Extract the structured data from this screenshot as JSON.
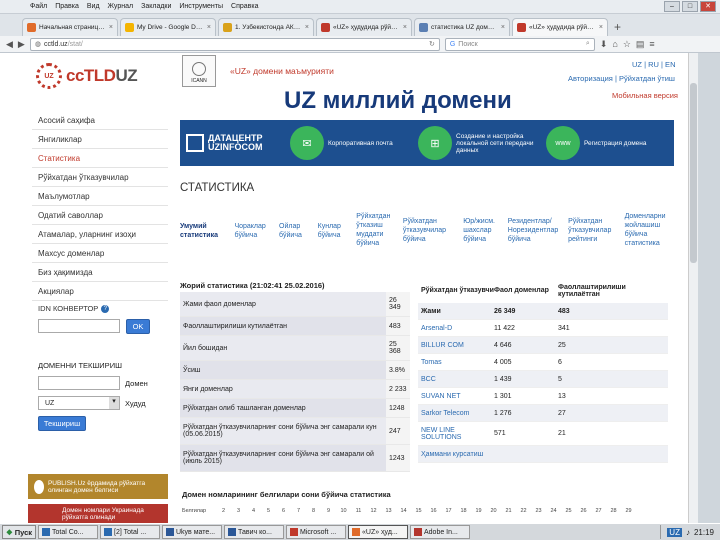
{
  "menu": [
    "Файл",
    "Правка",
    "Вид",
    "Журнал",
    "Закладки",
    "Инструменты",
    "Справка"
  ],
  "tabs": [
    {
      "label": "Начальная страница ...",
      "color": "#e06b2a"
    },
    {
      "label": "My Drive - Google Drive",
      "color": "#f4b400"
    },
    {
      "label": "1. Ўзбекистонда АКТ р...",
      "color": "#d9a21b"
    },
    {
      "label": "«UZ» ҳудудида рўйхат...",
      "color": "#c0392b"
    },
    {
      "label": "статистика UZ домени...",
      "color": "#5b7fb3"
    },
    {
      "label": "«UZ» ҳудудида рўйхат...",
      "color": "#c0392b",
      "active": true
    }
  ],
  "nav": {
    "url": "cctld.uz",
    "url_rest": "/stat/",
    "search_placeholder": "Поиск"
  },
  "header": {
    "logo_prefix": "ccTLD",
    "logo_suffix": "UZ",
    "badge": "UZ",
    "icann": "ICANN",
    "admin": "«UZ» домени маъмурияти",
    "langs": "UZ | RU | EN",
    "auth": "Авторизация | Рўйхатдан ўтиш",
    "mobile": "Мобильная версия"
  },
  "page_title": "UZ миллий домени",
  "sidebar": [
    {
      "label": "Асосий саҳифа"
    },
    {
      "label": "Янгиликлар"
    },
    {
      "label": "Статистика",
      "active": true
    },
    {
      "label": "Рўйхатдан ўтказувчилар"
    },
    {
      "label": "Маълумотлар"
    },
    {
      "label": "Одатий саволлар"
    },
    {
      "label": "Атамалар, уларнинг изоҳи"
    },
    {
      "label": "Махсус доменлар"
    },
    {
      "label": "Биз ҳақимизда"
    },
    {
      "label": "Акциялар"
    }
  ],
  "idn": {
    "title": "IDN КОНВЕРТОР",
    "ok": "OK"
  },
  "check": {
    "title": "ДОМЕННИ ТЕКШИРИШ",
    "domain_label": "Домен",
    "zone_label": "Худуд",
    "zone_value": "UZ",
    "button": "Текшириш"
  },
  "banners": [
    "PUBLISH.Uz ёрдамида рўйхатга олинган домен белгиси",
    "Домен номлари Украинада рўйхатга олинади"
  ],
  "dc_banner": {
    "brand_line1": "ДАТАЦЕНТР",
    "brand_line2": "UZINFOCOM",
    "services": [
      "Корпоративная почта",
      "Создание и настройка локальной сети передачи данных",
      "Регистрация домена"
    ]
  },
  "stat_heading": "СТАТИСТИКА",
  "stat_tabs": [
    "Умумий статистика",
    "Чораклар бўйича",
    "Ойлар бўйича",
    "Кунлар бўйича",
    "Рўйхатдан ўтказиш муддати бўйича",
    "Рўйхатдан ўтказувчилар бўйича",
    "Юр/жисм. шахслар бўйича",
    "Резидентлар/ Норезидентлар бўйича",
    "Рўйхатдан ўтказувчилар рейтинги",
    "Доменларни жойлашиш бўйича статистика"
  ],
  "current_stats": {
    "title": "Жорий статистика (21:02:41 25.02.2016)",
    "rows": [
      {
        "k": "Жами фаол доменлар",
        "v": "26 349"
      },
      {
        "k": "Фаоллаштирилиши кутилаётган",
        "v": "483"
      },
      {
        "k": "Йил бошидан",
        "v": "25 368"
      },
      {
        "k": "Ўсиш",
        "v": "3.8%"
      },
      {
        "k": "Янги доменлар",
        "v": "2 233"
      },
      {
        "k": "Рўйхатдан олиб ташланган доменлар",
        "v": "1248"
      },
      {
        "k": "Рўйхатдан ўтказувчиларнинг сони бўйича энг самарали кун (05.06.2015)",
        "v": "247"
      },
      {
        "k": "Рўйхатдан ўтказувчиларнинг сони бўйича энг самарали ой (июль 2015)",
        "v": "1243"
      }
    ]
  },
  "registrars": {
    "headers": [
      "Рўйхатдан ўтказувчи",
      "Фаол доменлар",
      "Фаоллаштирилиши кутилаётган"
    ],
    "rows": [
      {
        "name": "Жами",
        "active": "26 349",
        "pending": "483",
        "total": true
      },
      {
        "name": "Arsenal-D",
        "active": "11 422",
        "pending": "341"
      },
      {
        "name": "BILLUR COM",
        "active": "4 646",
        "pending": "25"
      },
      {
        "name": "Tomas",
        "active": "4 005",
        "pending": "6"
      },
      {
        "name": "BCC",
        "active": "1 439",
        "pending": "5"
      },
      {
        "name": "SUVAN NET",
        "active": "1 301",
        "pending": "13"
      },
      {
        "name": "Sarkor Telecom",
        "active": "1 276",
        "pending": "27"
      },
      {
        "name": "NEW LINE SOLUTIONS",
        "active": "571",
        "pending": "21"
      },
      {
        "name": "Ҳаммани курсатиш",
        "active": "",
        "pending": ""
      }
    ]
  },
  "daily": {
    "title": "Домен номларининг белгилари сони бўйича статистика",
    "row_label": "Белгилар",
    "days": [
      "2",
      "3",
      "4",
      "5",
      "6",
      "7",
      "8",
      "9",
      "10",
      "11",
      "12",
      "13",
      "14",
      "15",
      "16",
      "17",
      "18",
      "19",
      "20",
      "21",
      "22",
      "23",
      "24",
      "25",
      "26",
      "27",
      "28",
      "29"
    ]
  },
  "taskbar": {
    "start": "Пуск",
    "tasks": [
      {
        "label": "Total Co...",
        "color": "#2a6ab0"
      },
      {
        "label": "[2] Total ...",
        "color": "#2a6ab0"
      },
      {
        "label": "Ukyв мате...",
        "color": "#2b5797"
      },
      {
        "label": "Тавич ко...",
        "color": "#2b5797"
      },
      {
        "label": "Microsoft ...",
        "color": "#c0392b"
      },
      {
        "label": "«UZ» ҳуд...",
        "color": "#e06b2a",
        "active": true
      },
      {
        "label": "Adobe In...",
        "color": "#b3352d"
      }
    ],
    "lang": "UZ",
    "clock": "21:19"
  }
}
